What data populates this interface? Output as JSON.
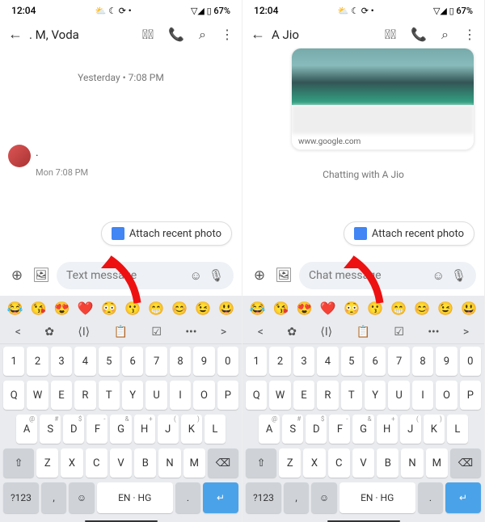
{
  "left": {
    "status": {
      "time": "12:04",
      "icons": "⛅ ☾ ⟳ •",
      "right": "▽◢ ▯ 67%"
    },
    "contact": ". M, Voda",
    "datestamp": "Yesterday • 7:08 PM",
    "msg": ".",
    "stamp2": "Mon 7:08 PM",
    "attach": "Attach recent photo",
    "placeholder": "Text message"
  },
  "right": {
    "status": {
      "time": "12:04",
      "icons": "⛅ ☾ ⟳ •",
      "right": "▽◢ ▯ 67%"
    },
    "contact": "A Jio",
    "cardurl": "www.google.com",
    "chatwith": "Chatting with A Jio",
    "attach": "Attach recent photo",
    "placeholder": "Chat message"
  },
  "kb": {
    "emojis": [
      "😂",
      "😘",
      "😍",
      "❤️",
      "😳",
      "😗",
      "😁",
      "😊",
      "😉",
      "😃"
    ],
    "tools": [
      "<",
      "✿",
      "⟨I⟩",
      "📋",
      "☑",
      "•••",
      ">"
    ],
    "row1": [
      "1",
      "2",
      "3",
      "4",
      "5",
      "6",
      "7",
      "8",
      "9",
      "0"
    ],
    "row2": [
      "Q",
      "W",
      "E",
      "R",
      "T",
      "Y",
      "U",
      "I",
      "O",
      "P"
    ],
    "row3": [
      "A",
      "S",
      "D",
      "F",
      "G",
      "H",
      "J",
      "K",
      "L"
    ],
    "row3sup": [
      "@",
      "#",
      "$",
      "-",
      "&",
      "+",
      "(",
      ")",
      ""
    ],
    "row4": [
      "Z",
      "X",
      "C",
      "V",
      "B",
      "N",
      "M"
    ],
    "shift": "⇧",
    "bksp": "⌫",
    "sym": "?123",
    "comma": ",",
    "smile": "☺",
    "lang": "EN · HG",
    "dot": ".",
    "enter": "↵"
  }
}
